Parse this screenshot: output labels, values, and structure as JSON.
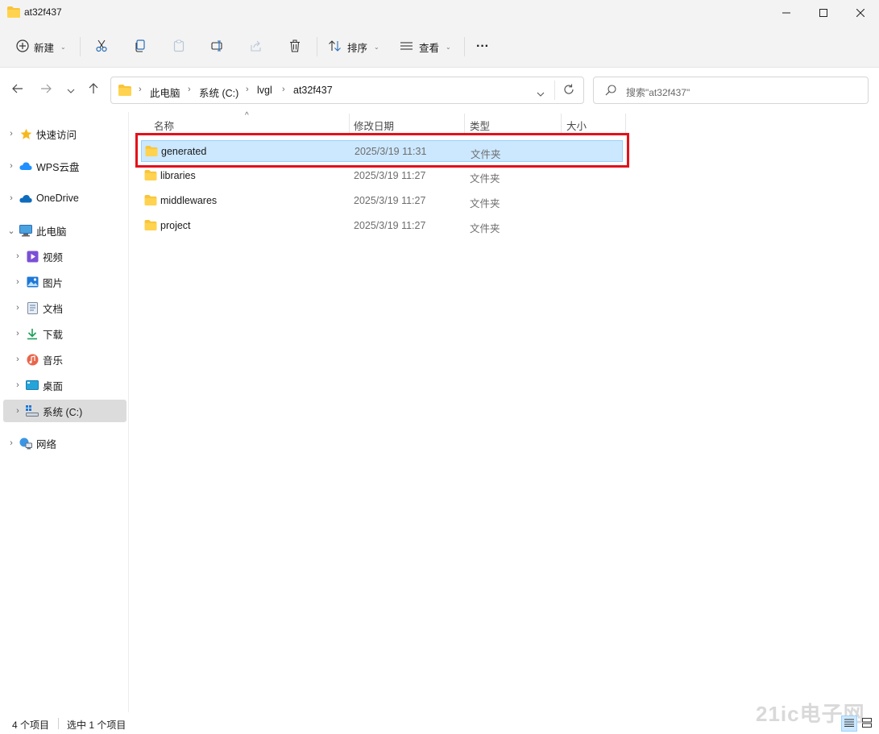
{
  "window": {
    "title": "at32f437"
  },
  "toolbar": {
    "new_label": "新建",
    "sort_label": "排序",
    "view_label": "查看",
    "more_label": "···"
  },
  "address": {
    "crumbs": [
      "此电脑",
      "系统 (C:)",
      "lvgl",
      "at32f437"
    ]
  },
  "search": {
    "placeholder": "搜索\"at32f437\""
  },
  "sidebar": {
    "items": [
      {
        "label": "快速访问",
        "icon": "star-icon"
      },
      {
        "label": "WPS云盘",
        "icon": "cloud-icon"
      },
      {
        "label": "OneDrive",
        "icon": "onedrive-icon"
      },
      {
        "label": "此电脑",
        "icon": "pc-icon"
      },
      {
        "label": "视频",
        "icon": "video-icon"
      },
      {
        "label": "图片",
        "icon": "picture-icon"
      },
      {
        "label": "文档",
        "icon": "document-icon"
      },
      {
        "label": "下载",
        "icon": "download-icon"
      },
      {
        "label": "音乐",
        "icon": "music-icon"
      },
      {
        "label": "桌面",
        "icon": "desktop-icon"
      },
      {
        "label": "系统 (C:)",
        "icon": "drive-icon"
      },
      {
        "label": "网络",
        "icon": "network-icon"
      }
    ]
  },
  "columns": {
    "name": "名称",
    "date": "修改日期",
    "type": "类型",
    "size": "大小"
  },
  "files": [
    {
      "name": "generated",
      "date": "2025/3/19 11:31",
      "type": "文件夹"
    },
    {
      "name": "libraries",
      "date": "2025/3/19 11:27",
      "type": "文件夹"
    },
    {
      "name": "middlewares",
      "date": "2025/3/19 11:27",
      "type": "文件夹"
    },
    {
      "name": "project",
      "date": "2025/3/19 11:27",
      "type": "文件夹"
    }
  ],
  "status": {
    "count": "4 个项目",
    "selected": "选中 1 个项目"
  },
  "watermark": "21ic电子网",
  "colors": {
    "selection": "#cce8ff",
    "highlight_box": "#e3111b",
    "folder": "#f8c43a"
  }
}
